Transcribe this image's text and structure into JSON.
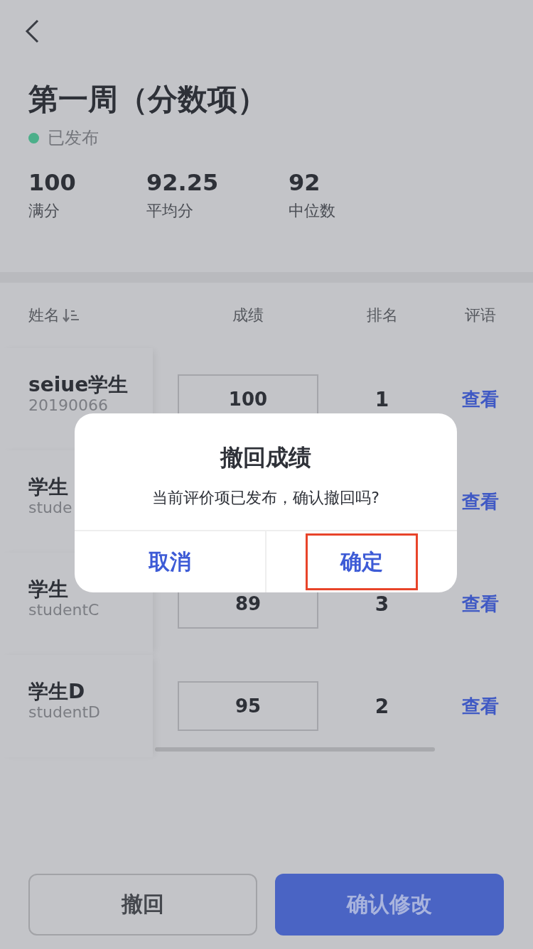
{
  "title": "第一周（分数项）",
  "status": {
    "label": "已发布",
    "published": true
  },
  "stats": [
    {
      "value": "100",
      "label": "满分"
    },
    {
      "value": "92.25",
      "label": "平均分"
    },
    {
      "value": "92",
      "label": "中位数"
    }
  ],
  "table": {
    "columns": [
      "姓名",
      "成绩",
      "排名",
      "评语"
    ],
    "rows": [
      {
        "name": "seiue学生",
        "id": "20190066",
        "score": "100",
        "rank": "1",
        "comment_link": "查看"
      },
      {
        "name": "学生",
        "id": "stude",
        "comment_link": "查看"
      },
      {
        "name": "学生",
        "id": "studentC",
        "score": "89",
        "rank": "3",
        "comment_link": "查看"
      },
      {
        "name": "学生D",
        "id": "studentD",
        "score": "95",
        "rank": "2",
        "comment_link": "查看"
      }
    ]
  },
  "dialog": {
    "title": "撤回成绩",
    "message": "当前评价项已发布，确认撤回吗?",
    "buttons": [
      {
        "label": "取消",
        "highlighted": false
      },
      {
        "label": "确定",
        "highlighted": true
      }
    ]
  },
  "footer_buttons": [
    {
      "label": "撤回",
      "kind": "outline"
    },
    {
      "label": "确认修改",
      "kind": "primary"
    }
  ]
}
